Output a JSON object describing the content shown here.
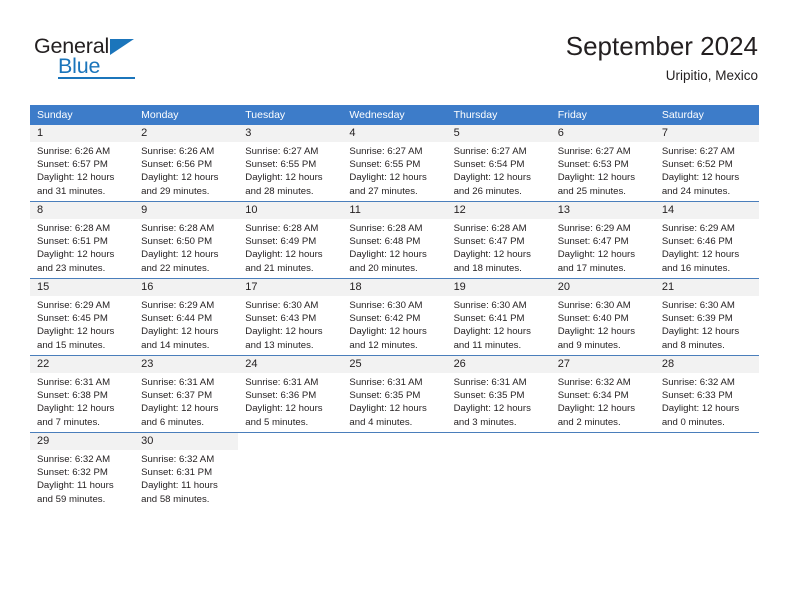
{
  "logo": {
    "word1": "General",
    "word2": "Blue",
    "flag_icon": "triangle-flag-icon"
  },
  "header": {
    "title": "September 2024",
    "subtitle": "Uripitio, Mexico"
  },
  "colors": {
    "header_blue": "#3d7cc9",
    "brand_blue": "#1b75bb",
    "day_number_bg": "#f2f2f2",
    "text": "#231f20"
  },
  "calendar": {
    "day_names": [
      "Sunday",
      "Monday",
      "Tuesday",
      "Wednesday",
      "Thursday",
      "Friday",
      "Saturday"
    ],
    "weeks": [
      [
        {
          "day": "1",
          "lines": [
            "Sunrise: 6:26 AM",
            "Sunset: 6:57 PM",
            "Daylight: 12 hours",
            "and 31 minutes."
          ]
        },
        {
          "day": "2",
          "lines": [
            "Sunrise: 6:26 AM",
            "Sunset: 6:56 PM",
            "Daylight: 12 hours",
            "and 29 minutes."
          ]
        },
        {
          "day": "3",
          "lines": [
            "Sunrise: 6:27 AM",
            "Sunset: 6:55 PM",
            "Daylight: 12 hours",
            "and 28 minutes."
          ]
        },
        {
          "day": "4",
          "lines": [
            "Sunrise: 6:27 AM",
            "Sunset: 6:55 PM",
            "Daylight: 12 hours",
            "and 27 minutes."
          ]
        },
        {
          "day": "5",
          "lines": [
            "Sunrise: 6:27 AM",
            "Sunset: 6:54 PM",
            "Daylight: 12 hours",
            "and 26 minutes."
          ]
        },
        {
          "day": "6",
          "lines": [
            "Sunrise: 6:27 AM",
            "Sunset: 6:53 PM",
            "Daylight: 12 hours",
            "and 25 minutes."
          ]
        },
        {
          "day": "7",
          "lines": [
            "Sunrise: 6:27 AM",
            "Sunset: 6:52 PM",
            "Daylight: 12 hours",
            "and 24 minutes."
          ]
        }
      ],
      [
        {
          "day": "8",
          "lines": [
            "Sunrise: 6:28 AM",
            "Sunset: 6:51 PM",
            "Daylight: 12 hours",
            "and 23 minutes."
          ]
        },
        {
          "day": "9",
          "lines": [
            "Sunrise: 6:28 AM",
            "Sunset: 6:50 PM",
            "Daylight: 12 hours",
            "and 22 minutes."
          ]
        },
        {
          "day": "10",
          "lines": [
            "Sunrise: 6:28 AM",
            "Sunset: 6:49 PM",
            "Daylight: 12 hours",
            "and 21 minutes."
          ]
        },
        {
          "day": "11",
          "lines": [
            "Sunrise: 6:28 AM",
            "Sunset: 6:48 PM",
            "Daylight: 12 hours",
            "and 20 minutes."
          ]
        },
        {
          "day": "12",
          "lines": [
            "Sunrise: 6:28 AM",
            "Sunset: 6:47 PM",
            "Daylight: 12 hours",
            "and 18 minutes."
          ]
        },
        {
          "day": "13",
          "lines": [
            "Sunrise: 6:29 AM",
            "Sunset: 6:47 PM",
            "Daylight: 12 hours",
            "and 17 minutes."
          ]
        },
        {
          "day": "14",
          "lines": [
            "Sunrise: 6:29 AM",
            "Sunset: 6:46 PM",
            "Daylight: 12 hours",
            "and 16 minutes."
          ]
        }
      ],
      [
        {
          "day": "15",
          "lines": [
            "Sunrise: 6:29 AM",
            "Sunset: 6:45 PM",
            "Daylight: 12 hours",
            "and 15 minutes."
          ]
        },
        {
          "day": "16",
          "lines": [
            "Sunrise: 6:29 AM",
            "Sunset: 6:44 PM",
            "Daylight: 12 hours",
            "and 14 minutes."
          ]
        },
        {
          "day": "17",
          "lines": [
            "Sunrise: 6:30 AM",
            "Sunset: 6:43 PM",
            "Daylight: 12 hours",
            "and 13 minutes."
          ]
        },
        {
          "day": "18",
          "lines": [
            "Sunrise: 6:30 AM",
            "Sunset: 6:42 PM",
            "Daylight: 12 hours",
            "and 12 minutes."
          ]
        },
        {
          "day": "19",
          "lines": [
            "Sunrise: 6:30 AM",
            "Sunset: 6:41 PM",
            "Daylight: 12 hours",
            "and 11 minutes."
          ]
        },
        {
          "day": "20",
          "lines": [
            "Sunrise: 6:30 AM",
            "Sunset: 6:40 PM",
            "Daylight: 12 hours",
            "and 9 minutes."
          ]
        },
        {
          "day": "21",
          "lines": [
            "Sunrise: 6:30 AM",
            "Sunset: 6:39 PM",
            "Daylight: 12 hours",
            "and 8 minutes."
          ]
        }
      ],
      [
        {
          "day": "22",
          "lines": [
            "Sunrise: 6:31 AM",
            "Sunset: 6:38 PM",
            "Daylight: 12 hours",
            "and 7 minutes."
          ]
        },
        {
          "day": "23",
          "lines": [
            "Sunrise: 6:31 AM",
            "Sunset: 6:37 PM",
            "Daylight: 12 hours",
            "and 6 minutes."
          ]
        },
        {
          "day": "24",
          "lines": [
            "Sunrise: 6:31 AM",
            "Sunset: 6:36 PM",
            "Daylight: 12 hours",
            "and 5 minutes."
          ]
        },
        {
          "day": "25",
          "lines": [
            "Sunrise: 6:31 AM",
            "Sunset: 6:35 PM",
            "Daylight: 12 hours",
            "and 4 minutes."
          ]
        },
        {
          "day": "26",
          "lines": [
            "Sunrise: 6:31 AM",
            "Sunset: 6:35 PM",
            "Daylight: 12 hours",
            "and 3 minutes."
          ]
        },
        {
          "day": "27",
          "lines": [
            "Sunrise: 6:32 AM",
            "Sunset: 6:34 PM",
            "Daylight: 12 hours",
            "and 2 minutes."
          ]
        },
        {
          "day": "28",
          "lines": [
            "Sunrise: 6:32 AM",
            "Sunset: 6:33 PM",
            "Daylight: 12 hours",
            "and 0 minutes."
          ]
        }
      ],
      [
        {
          "day": "29",
          "lines": [
            "Sunrise: 6:32 AM",
            "Sunset: 6:32 PM",
            "Daylight: 11 hours",
            "and 59 minutes."
          ]
        },
        {
          "day": "30",
          "lines": [
            "Sunrise: 6:32 AM",
            "Sunset: 6:31 PM",
            "Daylight: 11 hours",
            "and 58 minutes."
          ]
        },
        {
          "day": "",
          "lines": []
        },
        {
          "day": "",
          "lines": []
        },
        {
          "day": "",
          "lines": []
        },
        {
          "day": "",
          "lines": []
        },
        {
          "day": "",
          "lines": []
        }
      ]
    ]
  }
}
